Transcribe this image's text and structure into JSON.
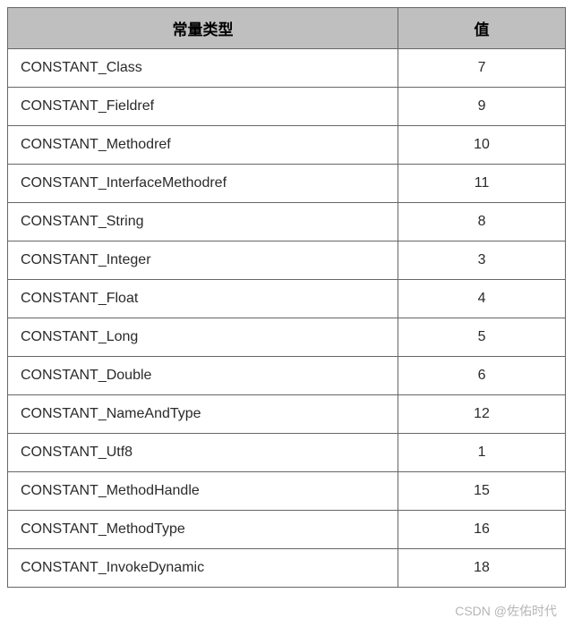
{
  "table": {
    "headers": {
      "type": "常量类型",
      "value": "值"
    },
    "rows": [
      {
        "type": "CONSTANT_Class",
        "value": "7"
      },
      {
        "type": "CONSTANT_Fieldref",
        "value": "9"
      },
      {
        "type": "CONSTANT_Methodref",
        "value": "10"
      },
      {
        "type": "CONSTANT_InterfaceMethodref",
        "value": "11"
      },
      {
        "type": "CONSTANT_String",
        "value": "8"
      },
      {
        "type": "CONSTANT_Integer",
        "value": "3"
      },
      {
        "type": "CONSTANT_Float",
        "value": "4"
      },
      {
        "type": "CONSTANT_Long",
        "value": "5"
      },
      {
        "type": "CONSTANT_Double",
        "value": "6"
      },
      {
        "type": "CONSTANT_NameAndType",
        "value": "12"
      },
      {
        "type": "CONSTANT_Utf8",
        "value": "1"
      },
      {
        "type": "CONSTANT_MethodHandle",
        "value": "15"
      },
      {
        "type": "CONSTANT_MethodType",
        "value": "16"
      },
      {
        "type": "CONSTANT_InvokeDynamic",
        "value": "18"
      }
    ]
  },
  "watermark": "CSDN @佐佑时代"
}
